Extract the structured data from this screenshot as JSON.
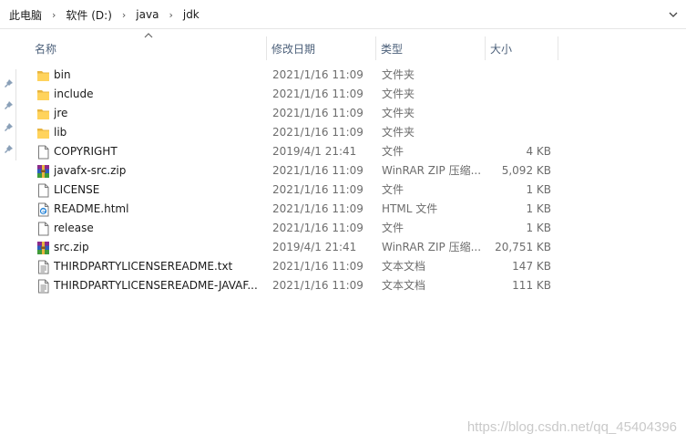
{
  "address_bar": {
    "crumbs": [
      "此电脑",
      "软件 (D:)",
      "java",
      "jdk"
    ],
    "dropdown_icon": "chevron-down-icon"
  },
  "columns": {
    "name": "名称",
    "date": "修改日期",
    "type": "类型",
    "size": "大小",
    "sort_indicator": "sort-up-icon"
  },
  "files": [
    {
      "name": "bin",
      "date": "2021/1/16 11:09",
      "type": "文件夹",
      "size": "",
      "icon": "folder"
    },
    {
      "name": "include",
      "date": "2021/1/16 11:09",
      "type": "文件夹",
      "size": "",
      "icon": "folder"
    },
    {
      "name": "jre",
      "date": "2021/1/16 11:09",
      "type": "文件夹",
      "size": "",
      "icon": "folder"
    },
    {
      "name": "lib",
      "date": "2021/1/16 11:09",
      "type": "文件夹",
      "size": "",
      "icon": "folder"
    },
    {
      "name": "COPYRIGHT",
      "date": "2019/4/1 21:41",
      "type": "文件",
      "size": "4 KB",
      "icon": "file"
    },
    {
      "name": "javafx-src.zip",
      "date": "2021/1/16 11:09",
      "type": "WinRAR ZIP 压缩...",
      "size": "5,092 KB",
      "icon": "winrar"
    },
    {
      "name": "LICENSE",
      "date": "2021/1/16 11:09",
      "type": "文件",
      "size": "1 KB",
      "icon": "file"
    },
    {
      "name": "README.html",
      "date": "2021/1/16 11:09",
      "type": "HTML 文件",
      "size": "1 KB",
      "icon": "html"
    },
    {
      "name": "release",
      "date": "2021/1/16 11:09",
      "type": "文件",
      "size": "1 KB",
      "icon": "file"
    },
    {
      "name": "src.zip",
      "date": "2019/4/1 21:41",
      "type": "WinRAR ZIP 压缩...",
      "size": "20,751 KB",
      "icon": "winrar"
    },
    {
      "name": "THIRDPARTYLICENSEREADME.txt",
      "date": "2021/1/16 11:09",
      "type": "文本文档",
      "size": "147 KB",
      "icon": "text"
    },
    {
      "name": "THIRDPARTYLICENSEREADME-JAVAF...",
      "date": "2021/1/16 11:09",
      "type": "文本文档",
      "size": "111 KB",
      "icon": "text"
    }
  ],
  "watermark": "https://blog.csdn.net/qq_45404396",
  "colors": {
    "folder": "#ffd35c",
    "header_text": "#4c607a",
    "secondary_text": "#6d6d6d",
    "pin": "#8aa0b8"
  }
}
